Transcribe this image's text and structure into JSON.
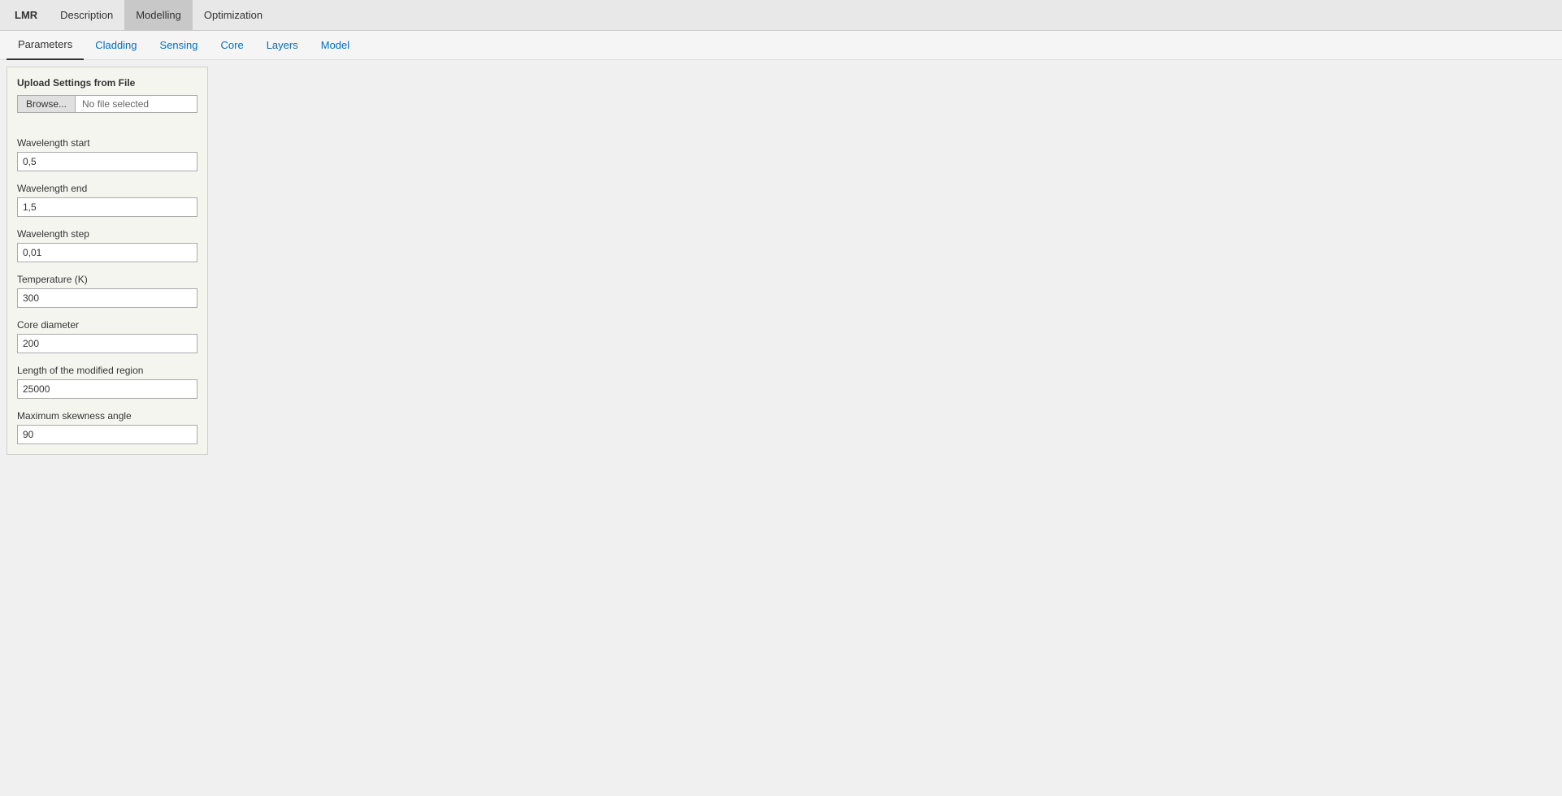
{
  "top_nav": {
    "logo": "LMR",
    "items": [
      {
        "label": "Description",
        "active": false
      },
      {
        "label": "Modelling",
        "active": true
      },
      {
        "label": "Optimization",
        "active": false
      }
    ]
  },
  "tabs": {
    "items": [
      {
        "label": "Parameters",
        "active": true
      },
      {
        "label": "Cladding",
        "active": false
      },
      {
        "label": "Sensing",
        "active": false
      },
      {
        "label": "Core",
        "active": false
      },
      {
        "label": "Layers",
        "active": false
      },
      {
        "label": "Model",
        "active": false
      }
    ]
  },
  "panel": {
    "upload_section": {
      "title": "Upload Settings from File",
      "browse_label": "Browse...",
      "file_placeholder": "No file selected"
    },
    "fields": [
      {
        "label": "Wavelength start",
        "value": "0,5"
      },
      {
        "label": "Wavelength end",
        "value": "1,5"
      },
      {
        "label": "Wavelength step",
        "value": "0,01"
      },
      {
        "label": "Temperature (K)",
        "value": "300"
      },
      {
        "label": "Core diameter",
        "value": "200"
      },
      {
        "label": "Length of the modified region",
        "value": "25000"
      },
      {
        "label": "Maximum skewness angle",
        "value": "90"
      }
    ]
  }
}
